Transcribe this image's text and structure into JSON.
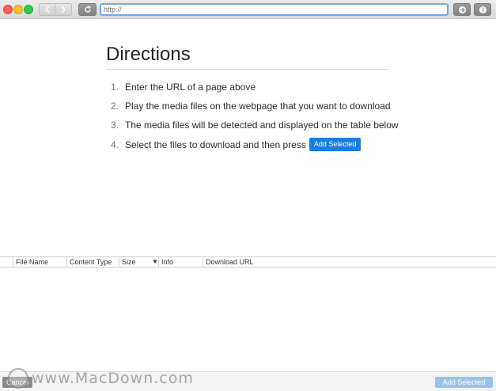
{
  "toolbar": {
    "url_placeholder": "http://"
  },
  "directions": {
    "title": "Directions",
    "steps": [
      {
        "num": "1.",
        "text": "Enter the URL of a page above"
      },
      {
        "num": "2.",
        "text": "Play the media files on the webpage that you want to download"
      },
      {
        "num": "3.",
        "text": "The media files will be detected and displayed on the table below"
      },
      {
        "num": "4.",
        "text": "Select the files to download and then press"
      }
    ],
    "inline_button": "Add Selected"
  },
  "table": {
    "columns": [
      "File Name",
      "Content Type",
      "Size",
      "Info",
      "Download URL"
    ],
    "sort_indicator": "▼"
  },
  "footer": {
    "cancel_label": "Cancel",
    "add_selected_label": "Add Selected"
  },
  "watermark": {
    "text": "www.MacDown.com"
  },
  "colors": {
    "accent": "#1a7de3",
    "add_disabled": "#9bc1ea",
    "traffic_red": "#fc5f57",
    "traffic_yellow": "#fdbc2e",
    "traffic_green": "#34c84a"
  }
}
